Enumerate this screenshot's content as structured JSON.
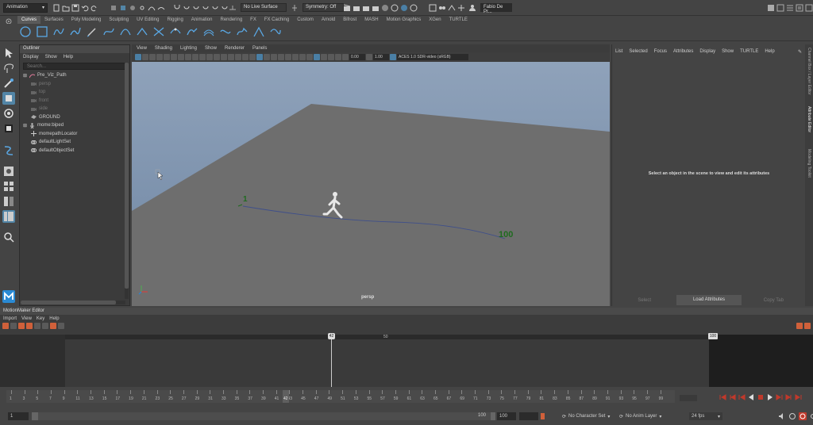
{
  "status_bar": {
    "menuset": "Animation",
    "live_surface": "No Live Surface",
    "symmetry": "Symmetry: Off",
    "user": "Fabio De Pr..."
  },
  "shelf_tabs": [
    "Curves",
    "Surfaces",
    "Poly Modeling",
    "Sculpting",
    "UV Editing",
    "Rigging",
    "Animation",
    "Rendering",
    "FX",
    "FX Caching",
    "Custom",
    "Arnold",
    "Bifrost",
    "MASH",
    "Motion Graphics",
    "XGen",
    "TURTLE"
  ],
  "outliner": {
    "title": "Outliner",
    "menu": [
      "Display",
      "Show",
      "Help"
    ],
    "search_placeholder": "Search...",
    "items": [
      {
        "label": "Pre_Viz_Path",
        "dim": false,
        "icon": "path-icon"
      },
      {
        "label": "persp",
        "dim": true,
        "icon": "camera-icon"
      },
      {
        "label": "top",
        "dim": true,
        "icon": "camera-icon"
      },
      {
        "label": "front",
        "dim": true,
        "icon": "camera-icon"
      },
      {
        "label": "side",
        "dim": true,
        "icon": "camera-icon"
      },
      {
        "label": "GROUND",
        "dim": false,
        "icon": "mesh-icon"
      },
      {
        "label": "mome:biped",
        "dim": false,
        "icon": "biped-icon"
      },
      {
        "label": "momepathLocator",
        "dim": false,
        "icon": "locator-icon"
      },
      {
        "label": "defaultLightSet",
        "dim": false,
        "icon": "set-icon"
      },
      {
        "label": "defaultObjectSet",
        "dim": false,
        "icon": "set-icon"
      }
    ]
  },
  "viewport": {
    "menu": [
      "View",
      "Shading",
      "Lighting",
      "Show",
      "Renderer",
      "Panels"
    ],
    "exposure": "0.00",
    "gamma": "1.00",
    "color_space": "ACES 1.0 SDR-video (sRGB)",
    "camera_label": "persp",
    "path_start": "1",
    "path_end": "100"
  },
  "attribute_editor": {
    "menu": [
      "List",
      "Selected",
      "Focus",
      "Attributes",
      "Display",
      "Show",
      "TURTLE",
      "Help"
    ],
    "message": "Select an object in the scene to view and edit its attributes",
    "buttons": {
      "select": "Select",
      "load": "Load Attributes",
      "copy": "Copy Tab"
    },
    "side_tabs": [
      "Channel Box / Layer Editor",
      "Attribute Editor",
      "Modeling Toolkit"
    ]
  },
  "motionmaker": {
    "title": "MotionMaker Editor",
    "menu": [
      "Import",
      "View",
      "Key",
      "Help"
    ],
    "marker_current": "42",
    "marker_mid": "50",
    "marker_end": "100"
  },
  "timeline": {
    "ticks": [
      "1",
      "3",
      "5",
      "7",
      "9",
      "11",
      "13",
      "15",
      "17",
      "19",
      "21",
      "23",
      "25",
      "27",
      "29",
      "31",
      "33",
      "35",
      "37",
      "39",
      "41",
      "43",
      "45",
      "47",
      "49",
      "51",
      "53",
      "55",
      "57",
      "59",
      "61",
      "63",
      "65",
      "67",
      "69",
      "71",
      "73",
      "75",
      "77",
      "79",
      "81",
      "83",
      "85",
      "87",
      "89",
      "91",
      "93",
      "95",
      "97",
      "99"
    ],
    "current_frame": "42",
    "range_start": "1",
    "range_start_inner": "1",
    "range_end_inner": "100",
    "range_end": "100",
    "character_set": "No Character Set",
    "anim_layer": "No Anim Layer",
    "fps": "24 fps"
  },
  "colors": {
    "accent": "#5285a6",
    "sky_top": "#7b8ea7",
    "ground": "#6e6e6e",
    "path_label": "#1f6b1f",
    "playhead": "#c8c8c8",
    "record_red": "#c0392b"
  }
}
